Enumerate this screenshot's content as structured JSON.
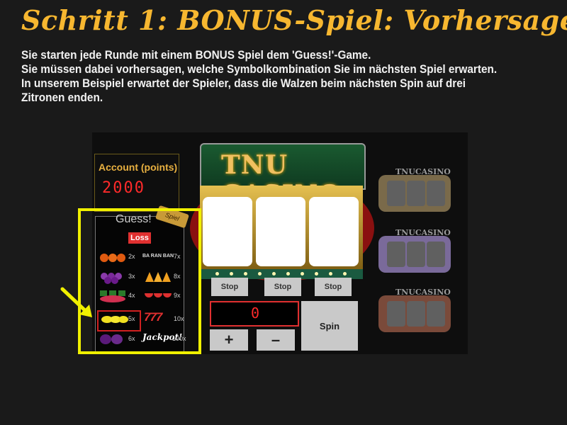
{
  "page": {
    "title": "Schritt 1: BONUS-Spiel: Vorhersage",
    "intro_line1": "Sie starten jede Runde mit einem BONUS Spiel dem 'Guess!'-Game.",
    "intro_line2": "Sie müssen dabei vorhersagen, welche Symbolkombination Sie im nächsten Spiel erwarten. In unserem Beispiel erwartet der Spieler, dass die Walzen beim nächsten Spin auf drei Zitronen enden."
  },
  "game": {
    "account_label": "Account (points)",
    "account_value": "2000",
    "guess_title": "Guess!",
    "guess_badge": "Spiel",
    "loss_label": "Loss",
    "marquee": "TNU CASINO",
    "mini_title": "TNUCASINO",
    "stop_label": "Stop",
    "bet_value": "0",
    "plus_label": "+",
    "minus_label": "–",
    "spin_label": "Spin",
    "guess_left": [
      {
        "symbol": "orange-icon",
        "mult": "2x",
        "color": "#e05a10"
      },
      {
        "symbol": "grapes-icon",
        "mult": "3x",
        "color": "#7a2a9a"
      },
      {
        "symbol": "watermelon-icon",
        "mult": "4x",
        "color": "#d03050"
      },
      {
        "symbol": "lemon-icon",
        "mult": "5x",
        "color": "#f0e020"
      },
      {
        "symbol": "plum-icon",
        "mult": "6x",
        "color": "#5a1a7a"
      }
    ],
    "guess_right": [
      {
        "symbol": "bar-icon",
        "mult": "7x",
        "label": "BA RAN BAN"
      },
      {
        "symbol": "bell-icon",
        "mult": "8x",
        "color": "#f0a020"
      },
      {
        "symbol": "melon-slice-icon",
        "mult": "9x",
        "color": "#e03030"
      },
      {
        "symbol": "seven-icon",
        "mult": "10x",
        "label": "777"
      },
      {
        "symbol": "jackpot-icon",
        "mult": "100x",
        "label": "Jackpot!"
      }
    ]
  }
}
